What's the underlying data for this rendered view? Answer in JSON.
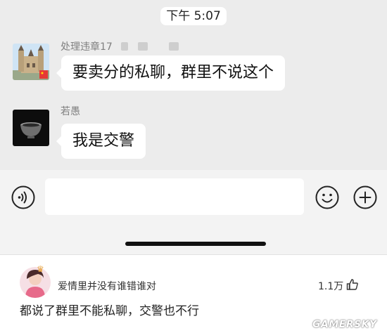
{
  "chat": {
    "timestamp": "下午 5:07",
    "messages": [
      {
        "sender": "处理违章17",
        "text": "要卖分的私聊，群里不说这个",
        "avatar_icon": "castle-avatar-icon"
      },
      {
        "sender": "若愚",
        "text": "我是交警",
        "avatar_icon": "bowl-avatar-icon"
      }
    ]
  },
  "input_bar": {
    "voice_icon": "voice-icon",
    "emoji_icon": "emoji-icon",
    "plus_icon": "plus-icon",
    "message_value": ""
  },
  "comment": {
    "user": "爱情里并没有谁错谁对",
    "likes": "1.1万",
    "text": "都说了群里不能私聊，交警也不行",
    "like_icon": "thumbs-up-icon"
  },
  "watermark": "GAMERSKY",
  "colors": {
    "chat_bg": "#ececec",
    "bubble": "#ffffff",
    "input_bar_bg": "#f3f3f3",
    "crown": "#e6a23c",
    "flag_red": "#e53935"
  }
}
